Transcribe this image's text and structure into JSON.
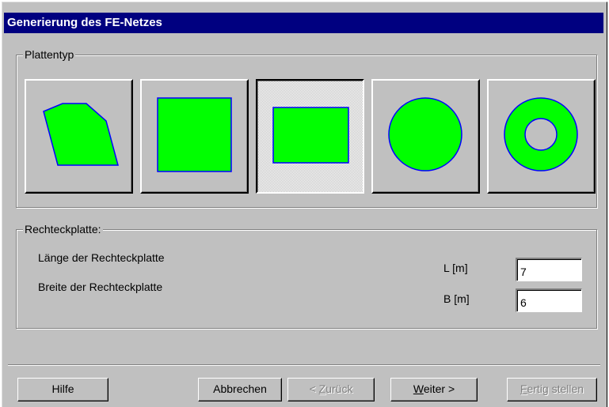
{
  "window": {
    "title": "Generierung des FE-Netzes"
  },
  "plattentyp": {
    "label": "Plattentyp",
    "options": [
      {
        "name": "polygon",
        "pressed": false
      },
      {
        "name": "square",
        "pressed": false
      },
      {
        "name": "rectangle",
        "pressed": true
      },
      {
        "name": "circle",
        "pressed": false
      },
      {
        "name": "ring",
        "pressed": false
      }
    ],
    "shape_fill": "#00ff00",
    "shape_stroke": "#0000ff"
  },
  "rechteck": {
    "label": "Rechteckplatte:",
    "laenge_label": "Länge der Rechteckplatte",
    "breite_label": "Breite der Rechteckplatte",
    "l_unit": "L [m]",
    "b_unit": "B [m]",
    "l_value": "7",
    "b_value": "6"
  },
  "buttons": {
    "hilfe": "Hilfe",
    "abbrechen": "Abbrechen",
    "zurueck_mnemonic": "Z",
    "zurueck_rest": "urück",
    "zurueck_prefix": "< ",
    "weiter_mnemonic": "W",
    "weiter_rest": "eiter >",
    "fertig_mnemonic": "F",
    "fertig_rest": "ertig stellen"
  }
}
